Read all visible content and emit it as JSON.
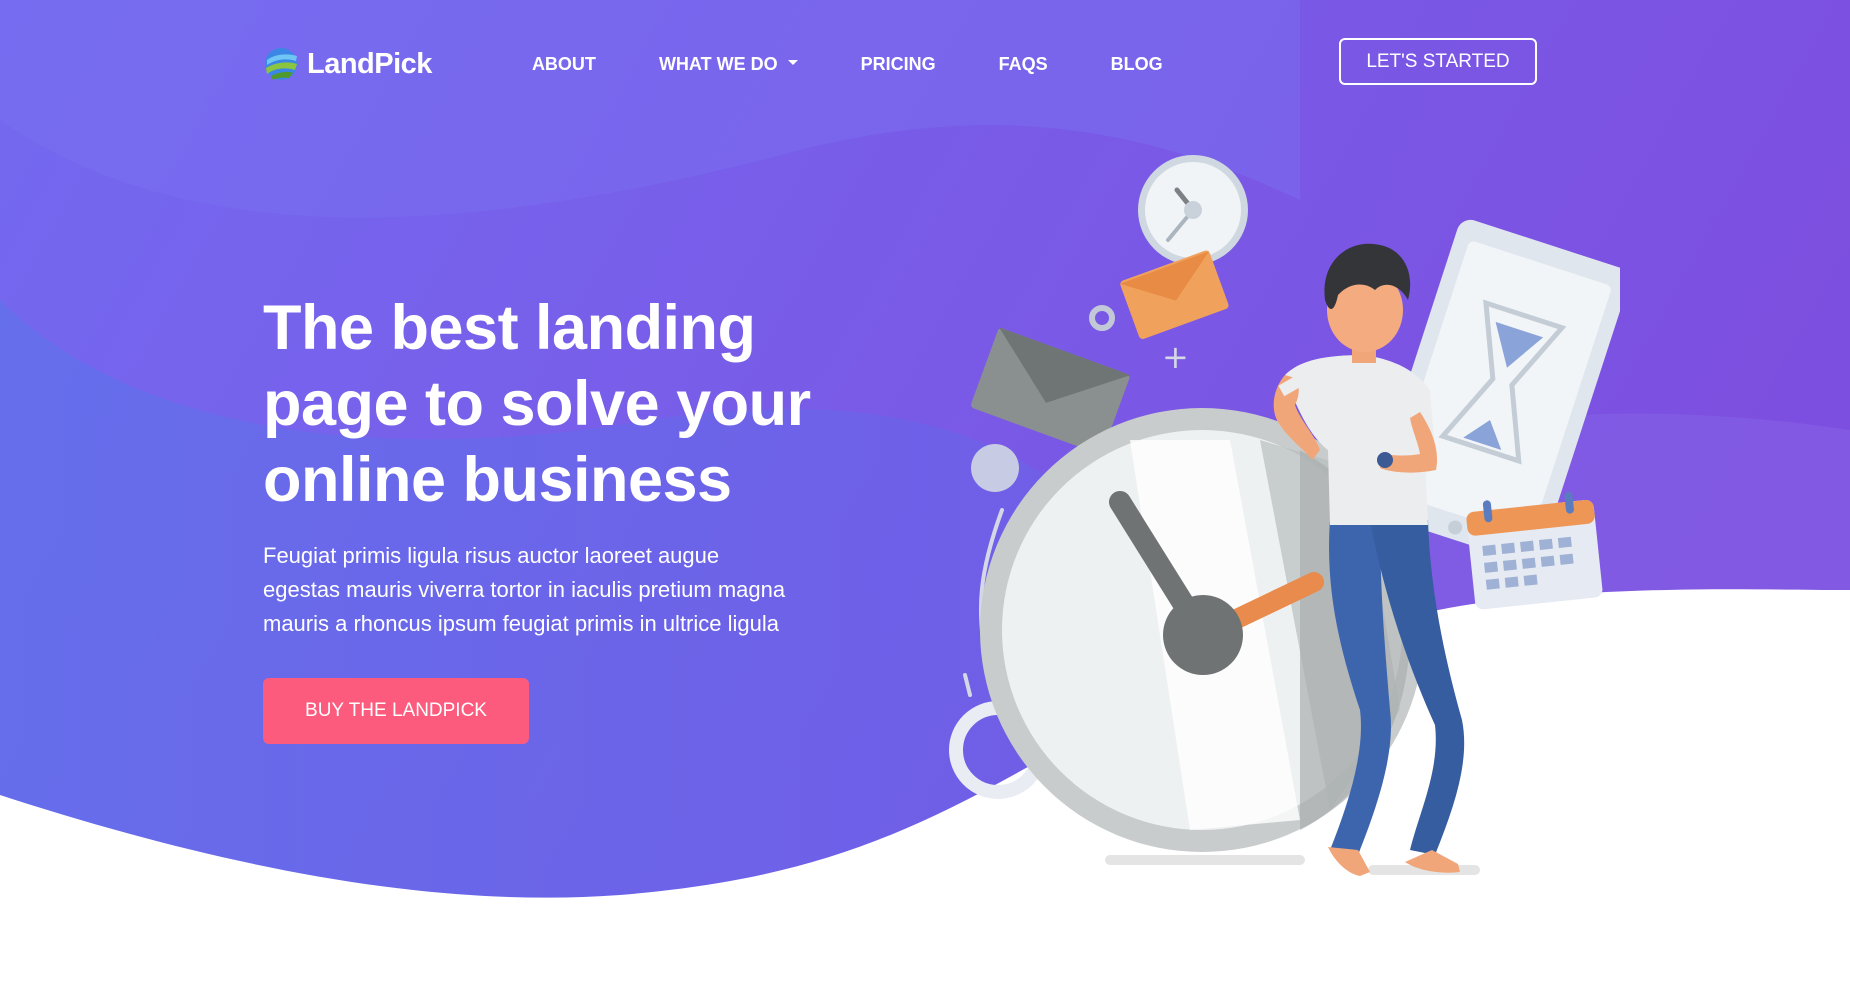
{
  "brand": {
    "name": "LandPick"
  },
  "nav": {
    "items": [
      {
        "label": "ABOUT"
      },
      {
        "label": "WHAT WE DO",
        "has_dropdown": true
      },
      {
        "label": "PRICING"
      },
      {
        "label": "FAQS"
      },
      {
        "label": "BLOG"
      }
    ],
    "cta_label": "LET'S STARTED"
  },
  "hero": {
    "title_lines": [
      "The best landing",
      "page to solve your",
      "online business"
    ],
    "text_lines": [
      "Feugiat primis ligula risus auctor laoreet augue",
      "egestas mauris viverra tortor in iaculis pretium magna",
      "mauris a rhoncus ipsum feugiat primis in ultrice ligula"
    ],
    "button_label": "BUY THE LANDPICK"
  },
  "colors": {
    "gradient_start": "#7469f0",
    "gradient_end": "#7d4fe0",
    "button_pink": "#fc5b7e",
    "text_white": "#ffffff"
  },
  "icons": {
    "logo": "landpick-globe-logo",
    "dropdown": "caret-down-icon"
  },
  "illustration": {
    "subject": "man leaning on stopwatch with phone, envelopes, wall clock and calendar"
  }
}
